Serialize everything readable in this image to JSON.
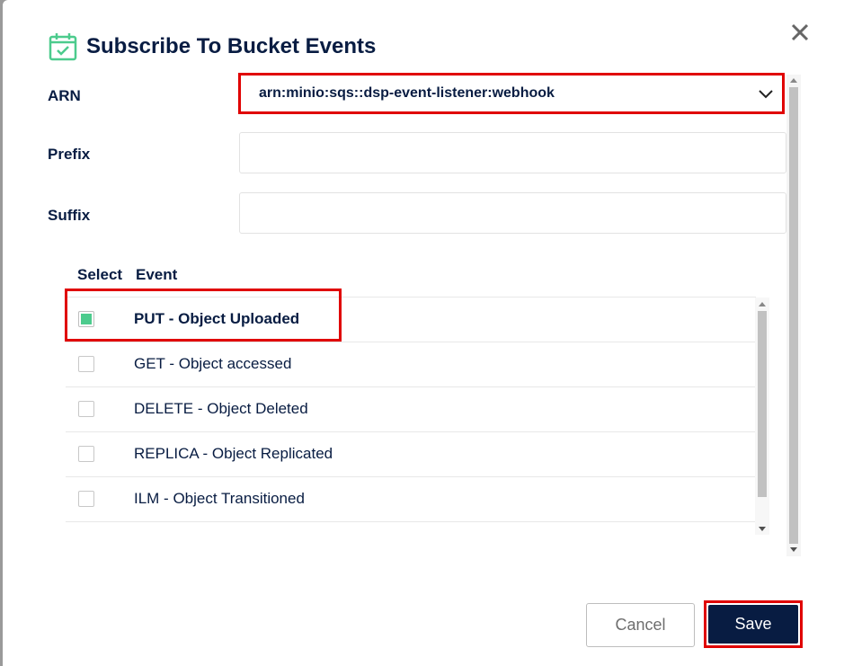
{
  "dialog": {
    "title": "Subscribe To Bucket Events"
  },
  "form": {
    "arn_label": "ARN",
    "arn_value": "arn:minio:sqs::dsp-event-listener:webhook",
    "prefix_label": "Prefix",
    "prefix_value": "",
    "suffix_label": "Suffix",
    "suffix_value": ""
  },
  "table": {
    "headers": [
      "Select",
      "Event"
    ],
    "rows": [
      {
        "label": "PUT - Object Uploaded",
        "checked": true
      },
      {
        "label": "GET - Object accessed",
        "checked": false
      },
      {
        "label": "DELETE - Object Deleted",
        "checked": false
      },
      {
        "label": "REPLICA - Object Replicated",
        "checked": false
      },
      {
        "label": "ILM - Object Transitioned",
        "checked": false
      }
    ]
  },
  "buttons": {
    "cancel": "Cancel",
    "save": "Save"
  },
  "colors": {
    "primary": "#081c42",
    "accent": "#4ccb8d",
    "highlight": "#e00000"
  },
  "icons": {
    "title": "calendar-check-icon",
    "close": "close-icon",
    "dropdown": "chevron-down-icon"
  }
}
